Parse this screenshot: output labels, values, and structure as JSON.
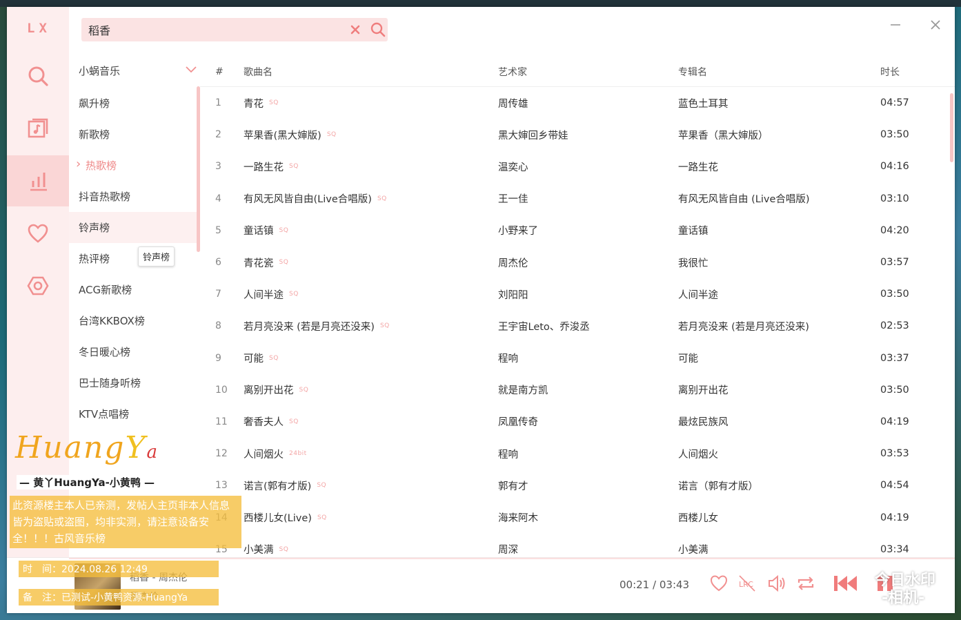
{
  "app": {
    "logo": "LX"
  },
  "search": {
    "value": "稻香"
  },
  "source": {
    "label": "小蜗音乐"
  },
  "boards": [
    "飙升榜",
    "新歌榜",
    "热歌榜",
    "抖音热歌榜",
    "铃声榜",
    "热评榜",
    "ACG新歌榜",
    "台湾KKBOX榜",
    "冬日暖心榜",
    "巴士随身听榜",
    "KTV点唱榜"
  ],
  "active_board": "热歌榜",
  "tooltip": "铃声榜",
  "table": {
    "headers": {
      "num": "#",
      "name": "歌曲名",
      "artist": "艺术家",
      "album": "专辑名",
      "duration": "时长"
    },
    "rows": [
      {
        "num": "1",
        "name": "青花",
        "tag": "SQ",
        "artist": "周传雄",
        "album": "蓝色土耳其",
        "duration": "04:57"
      },
      {
        "num": "2",
        "name": "苹果香(黑大婶版)",
        "tag": "SQ",
        "artist": "黑大婶回乡带娃",
        "album": "苹果香（黑大婶版）",
        "duration": "03:50"
      },
      {
        "num": "3",
        "name": "一路生花",
        "tag": "SQ",
        "artist": "温奕心",
        "album": "一路生花",
        "duration": "04:16"
      },
      {
        "num": "4",
        "name": "有风无风皆自由(Live合唱版)",
        "tag": "SQ",
        "artist": "王一佳",
        "album": "有风无风皆自由 (Live合唱版)",
        "duration": "03:10"
      },
      {
        "num": "5",
        "name": "童话镇",
        "tag": "SQ",
        "artist": "小野来了",
        "album": "童话镇",
        "duration": "04:20"
      },
      {
        "num": "6",
        "name": "青花瓷",
        "tag": "SQ",
        "artist": "周杰伦",
        "album": "我很忙",
        "duration": "03:57"
      },
      {
        "num": "7",
        "name": "人间半途",
        "tag": "SQ",
        "artist": "刘阳阳",
        "album": "人间半途",
        "duration": "03:50"
      },
      {
        "num": "8",
        "name": "若月亮没来 (若是月亮还没来)",
        "tag": "SQ",
        "artist": "王宇宙Leto、乔浚丞",
        "album": "若月亮没来 (若是月亮还没来)",
        "duration": "02:53"
      },
      {
        "num": "9",
        "name": "可能",
        "tag": "SQ",
        "artist": "程响",
        "album": "可能",
        "duration": "03:37"
      },
      {
        "num": "10",
        "name": "离别开出花",
        "tag": "SQ",
        "artist": "就是南方凯",
        "album": "离别开出花",
        "duration": "03:50"
      },
      {
        "num": "11",
        "name": "奢香夫人",
        "tag": "SQ",
        "artist": "凤凰传奇",
        "album": "最炫民族风",
        "duration": "04:19"
      },
      {
        "num": "12",
        "name": "人间烟火",
        "tag": "24bit",
        "artist": "程响",
        "album": "人间烟火",
        "duration": "03:53"
      },
      {
        "num": "13",
        "name": "诺言(郭有才版)",
        "tag": "SQ",
        "artist": "郭有才",
        "album": "诺言（郭有才版）",
        "duration": "04:54"
      },
      {
        "num": "14",
        "name": "西楼儿女(Live)",
        "tag": "SQ",
        "artist": "海来阿木",
        "album": "西楼儿女",
        "duration": "04:19"
      },
      {
        "num": "15",
        "name": "小美满",
        "tag": "SQ",
        "artist": "周深",
        "album": "小美满",
        "duration": "03:34"
      }
    ]
  },
  "player": {
    "title": "稻香 - 周杰伦",
    "artist": "周杰伦",
    "current": "00:21",
    "separator": "/",
    "total": "03:43",
    "progress": 0.094
  },
  "watermark": {
    "logo_h": "Huang",
    "logo_y": "Y",
    "logo_a": "a",
    "sub": "— 黄丫HuangYa-小黄鸭 —",
    "warn": "此资源楼主本人已亲测，发帖人主页非本人信息皆为盗贴或盗图，均非实测，请注意设备安全！！！古风音乐榜",
    "time": "时　间：2024.08.26 12:49",
    "note": "备　注：已测试-小黄鸭资源-HuangYa"
  },
  "stamp": {
    "line1": "今日水印",
    "line2": "-相机-"
  },
  "colors": {
    "accent": "#ef8a8a",
    "rail_bg": "#fdeeee",
    "search_bg": "#fbe3e3"
  },
  "icons": {
    "rail": [
      "search-icon",
      "music-library-icon",
      "leaderboard-icon",
      "heart-icon",
      "settings-icon"
    ],
    "controls": [
      "heart-icon",
      "lyrics-icon",
      "volume-icon",
      "repeat-icon",
      "previous-icon",
      "play-pause-icon"
    ]
  }
}
